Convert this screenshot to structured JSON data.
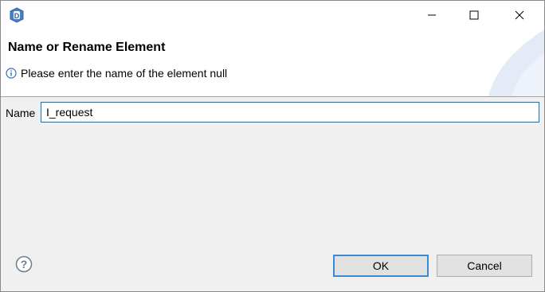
{
  "dialog": {
    "title": "Name or Rename Element",
    "message": "Please enter the name of the element null"
  },
  "icons": {
    "app": "eclipse-dialog-app-icon",
    "info": "info-icon",
    "help": "help-icon"
  },
  "form": {
    "name_label": "Name",
    "name_value": "I_request"
  },
  "buttons": {
    "ok": "OK",
    "cancel": "Cancel"
  },
  "colors": {
    "focus_border": "#0a74c9",
    "default_button_border": "#3c8ad8"
  }
}
